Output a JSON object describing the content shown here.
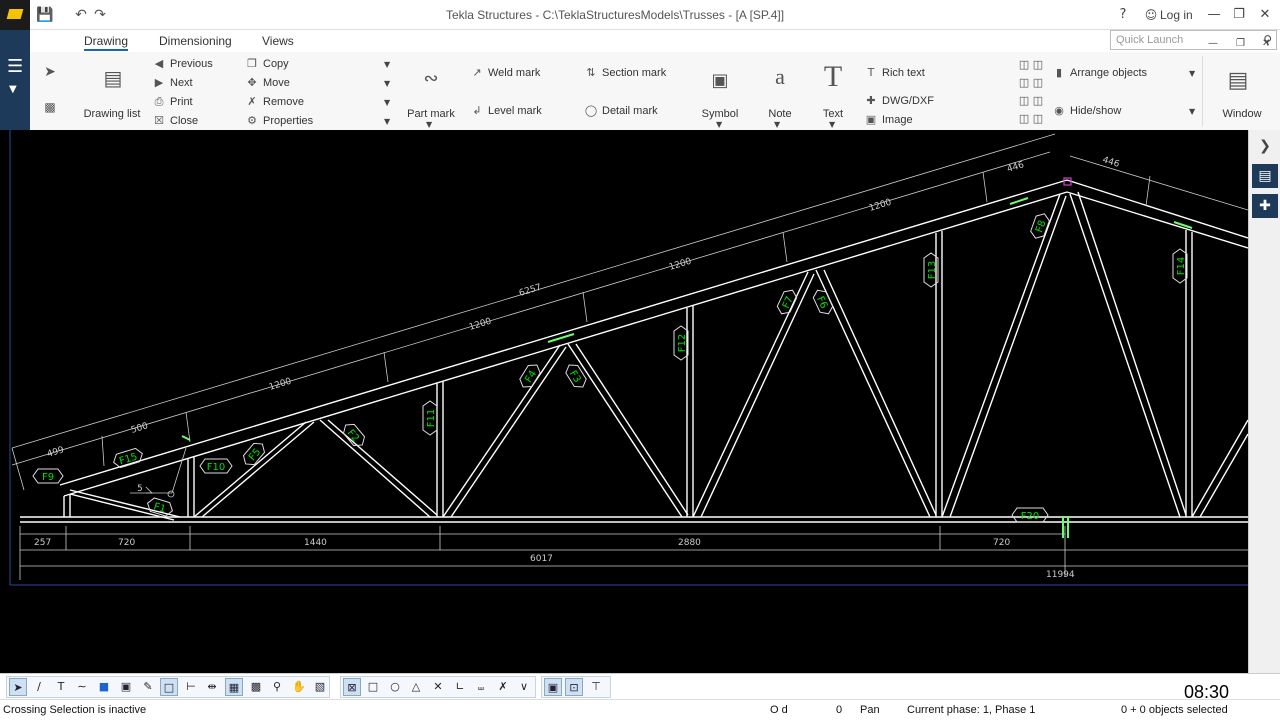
{
  "window": {
    "title": "Tekla Structures - C:\\TeklaStructuresModels\\Trusses - [A   [SP.4]]",
    "login_label": "Log in",
    "help_icon": "?"
  },
  "ribbon": {
    "tabs": [
      {
        "label": "Drawing",
        "active": true
      },
      {
        "label": "Dimensioning",
        "active": false
      },
      {
        "label": "Views",
        "active": false
      }
    ],
    "quick_launch_placeholder": "Quick Launch",
    "drawing_list_label": "Drawing list",
    "nav": [
      "Previous",
      "Next",
      "Print",
      "Close"
    ],
    "edit": [
      "Copy",
      "Move",
      "Remove",
      "Properties"
    ],
    "part_mark_label": "Part mark",
    "weld_mark_label": "Weld mark",
    "level_mark_label": "Level mark",
    "section_mark_label": "Section mark",
    "detail_mark_label": "Detail mark",
    "symbol_label": "Symbol",
    "note_label": "Note",
    "text_label": "Text",
    "rich_text_label": "Rich text",
    "dwg_label": "DWG/DXF",
    "image_label": "Image",
    "arrange_label": "Arrange objects",
    "hideshow_label": "Hide/show",
    "window_label": "Window"
  },
  "drawing": {
    "part_marks": [
      "F9",
      "F15",
      "F10",
      "F1",
      "F5",
      "F2",
      "F11",
      "F4",
      "F3",
      "F12",
      "F7",
      "F6",
      "F13",
      "F8",
      "F14",
      "F20"
    ],
    "slope_dims": [
      "499",
      "500",
      "1200",
      "1200",
      "1200",
      "1200",
      "446",
      "6257",
      "446"
    ],
    "bottom_dims": [
      "257",
      "720",
      "1440",
      "2880",
      "720"
    ],
    "overall_dims": [
      "6017",
      "11994"
    ],
    "weld_size": "5"
  },
  "status": {
    "crossing": "Crossing Selection is inactive",
    "od": "O d",
    "zero": "0",
    "pan": "Pan",
    "phase": "Current phase: 1, Phase 1",
    "selected": "0 + 0 objects selected",
    "clock": "08:30"
  },
  "colors": {
    "ribbon_accent": "#1e64b4",
    "canvas_bg": "#000000",
    "mark_text": "#00e000",
    "sidebar_dark": "#1e3a5a"
  }
}
